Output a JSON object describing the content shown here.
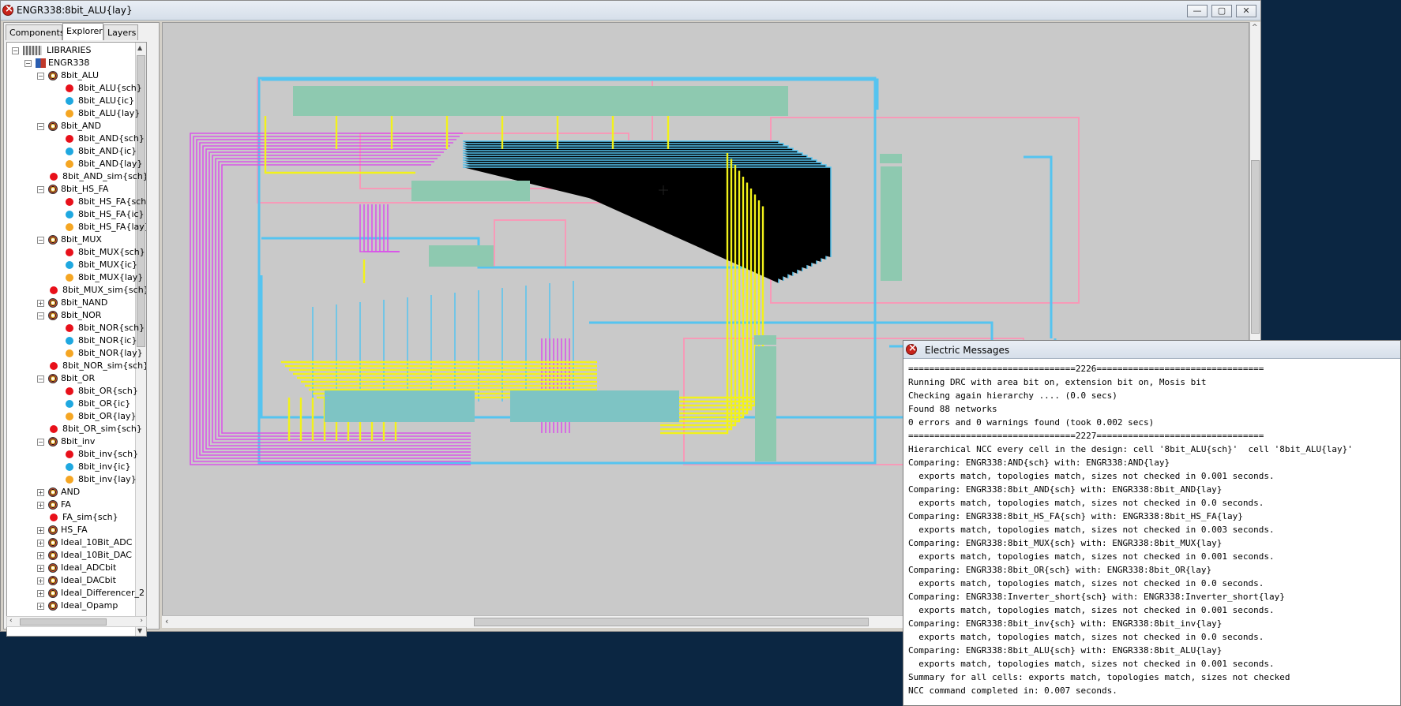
{
  "window": {
    "title": "ENGR338:8bit_ALU{lay}",
    "minimize": "—",
    "maximize": "▢",
    "close": "✕"
  },
  "tabs": [
    {
      "label": "Components"
    },
    {
      "label": "Explorer"
    },
    {
      "label": "Layers"
    }
  ],
  "tree": [
    {
      "label": "LIBRARIES",
      "level": 0,
      "icon": "libraries-icon",
      "expander": "⊟"
    },
    {
      "label": "ENGR338",
      "level": 1,
      "icon": "library-icon",
      "expander": "⊟"
    },
    {
      "label": "8bit_ALU",
      "level": 2,
      "icon": "cell-icon",
      "expander": "⊟"
    },
    {
      "label": "8bit_ALU{sch}",
      "level": 3,
      "icon": "schematic-dot-icon"
    },
    {
      "label": "8bit_ALU{ic}",
      "level": 3,
      "icon": "icon-dot-icon"
    },
    {
      "label": "8bit_ALU{lay}",
      "level": 3,
      "icon": "layout-dot-icon"
    },
    {
      "label": "8bit_AND",
      "level": 2,
      "icon": "cell-icon",
      "expander": "⊟"
    },
    {
      "label": "8bit_AND{sch}",
      "level": 3,
      "icon": "schematic-dot-icon"
    },
    {
      "label": "8bit_AND{ic}",
      "level": 3,
      "icon": "icon-dot-icon"
    },
    {
      "label": "8bit_AND{lay}",
      "level": 3,
      "icon": "layout-dot-icon"
    },
    {
      "label": "8bit_AND_sim{sch}",
      "level": 2,
      "icon": "schematic-dot-icon"
    },
    {
      "label": "8bit_HS_FA",
      "level": 2,
      "icon": "cell-icon",
      "expander": "⊟"
    },
    {
      "label": "8bit_HS_FA{sch",
      "level": 3,
      "icon": "schematic-dot-icon"
    },
    {
      "label": "8bit_HS_FA{ic}",
      "level": 3,
      "icon": "icon-dot-icon"
    },
    {
      "label": "8bit_HS_FA{lay}",
      "level": 3,
      "icon": "layout-dot-icon"
    },
    {
      "label": "8bit_MUX",
      "level": 2,
      "icon": "cell-icon",
      "expander": "⊟"
    },
    {
      "label": "8bit_MUX{sch}",
      "level": 3,
      "icon": "schematic-dot-icon"
    },
    {
      "label": "8bit_MUX{ic}",
      "level": 3,
      "icon": "icon-dot-icon"
    },
    {
      "label": "8bit_MUX{lay}",
      "level": 3,
      "icon": "layout-dot-icon"
    },
    {
      "label": "8bit_MUX_sim{sch}",
      "level": 2,
      "icon": "schematic-dot-icon"
    },
    {
      "label": "8bit_NAND",
      "level": 2,
      "icon": "cell-icon",
      "expander": "⊞"
    },
    {
      "label": "8bit_NOR",
      "level": 2,
      "icon": "cell-icon",
      "expander": "⊟"
    },
    {
      "label": "8bit_NOR{sch}",
      "level": 3,
      "icon": "schematic-dot-icon"
    },
    {
      "label": "8bit_NOR{ic}",
      "level": 3,
      "icon": "icon-dot-icon"
    },
    {
      "label": "8bit_NOR{lay}",
      "level": 3,
      "icon": "layout-dot-icon"
    },
    {
      "label": "8bit_NOR_sim{sch}",
      "level": 2,
      "icon": "schematic-dot-icon"
    },
    {
      "label": "8bit_OR",
      "level": 2,
      "icon": "cell-icon",
      "expander": "⊟"
    },
    {
      "label": "8bit_OR{sch}",
      "level": 3,
      "icon": "schematic-dot-icon"
    },
    {
      "label": "8bit_OR{ic}",
      "level": 3,
      "icon": "icon-dot-icon"
    },
    {
      "label": "8bit_OR{lay}",
      "level": 3,
      "icon": "layout-dot-icon"
    },
    {
      "label": "8bit_OR_sim{sch}",
      "level": 2,
      "icon": "schematic-dot-icon"
    },
    {
      "label": "8bit_inv",
      "level": 2,
      "icon": "cell-icon",
      "expander": "⊟"
    },
    {
      "label": "8bit_inv{sch}",
      "level": 3,
      "icon": "schematic-dot-icon"
    },
    {
      "label": "8bit_inv{ic}",
      "level": 3,
      "icon": "icon-dot-icon"
    },
    {
      "label": "8bit_inv{lay}",
      "level": 3,
      "icon": "layout-dot-icon"
    },
    {
      "label": "AND",
      "level": 2,
      "icon": "cell-icon",
      "expander": "⊞"
    },
    {
      "label": "FA",
      "level": 2,
      "icon": "cell-icon",
      "expander": "⊞"
    },
    {
      "label": "FA_sim{sch}",
      "level": 2,
      "icon": "schematic-dot-icon"
    },
    {
      "label": "HS_FA",
      "level": 2,
      "icon": "cell-icon",
      "expander": "⊞"
    },
    {
      "label": "Ideal_10Bit_ADC",
      "level": 2,
      "icon": "cell-icon",
      "expander": "⊞"
    },
    {
      "label": "Ideal_10Bit_DAC",
      "level": 2,
      "icon": "cell-icon",
      "expander": "⊞"
    },
    {
      "label": "Ideal_ADCbit",
      "level": 2,
      "icon": "cell-icon",
      "expander": "⊞"
    },
    {
      "label": "Ideal_DACbit",
      "level": 2,
      "icon": "cell-icon",
      "expander": "⊞"
    },
    {
      "label": "Ideal_Differencer_2",
      "level": 2,
      "icon": "cell-icon",
      "expander": "⊞"
    },
    {
      "label": "Ideal_Opamp",
      "level": 2,
      "icon": "cell-icon",
      "expander": "⊞"
    }
  ],
  "colors": {
    "schematic": "#e8101a",
    "icon_view": "#1fa8e0",
    "layout": "#f5a623",
    "poly_magenta": "#d957e8",
    "metal_blue": "#55c4f0",
    "metal_yellow": "#f2f21a",
    "outline_pink": "#f79ab8",
    "well_green": "#8ec9b0",
    "canvas_bg": "#c9c9c9",
    "desktop": "#0b2642"
  },
  "messages": {
    "title": "Electric Messages",
    "lines": [
      "================================2226================================",
      "Running DRC with area bit on, extension bit on, Mosis bit",
      "Checking again hierarchy .... (0.0 secs)",
      "Found 88 networks",
      "0 errors and 0 warnings found (took 0.002 secs)",
      "================================2227================================",
      "Hierarchical NCC every cell in the design: cell '8bit_ALU{sch}'  cell '8bit_ALU{lay}'",
      "Comparing: ENGR338:AND{sch} with: ENGR338:AND{lay}",
      "  exports match, topologies match, sizes not checked in 0.001 seconds.",
      "Comparing: ENGR338:8bit_AND{sch} with: ENGR338:8bit_AND{lay}",
      "  exports match, topologies match, sizes not checked in 0.0 seconds.",
      "Comparing: ENGR338:8bit_HS_FA{sch} with: ENGR338:8bit_HS_FA{lay}",
      "  exports match, topologies match, sizes not checked in 0.003 seconds.",
      "Comparing: ENGR338:8bit_MUX{sch} with: ENGR338:8bit_MUX{lay}",
      "  exports match, topologies match, sizes not checked in 0.001 seconds.",
      "Comparing: ENGR338:8bit_OR{sch} with: ENGR338:8bit_OR{lay}",
      "  exports match, topologies match, sizes not checked in 0.0 seconds.",
      "Comparing: ENGR338:Inverter_short{sch} with: ENGR338:Inverter_short{lay}",
      "  exports match, topologies match, sizes not checked in 0.001 seconds.",
      "Comparing: ENGR338:8bit_inv{sch} with: ENGR338:8bit_inv{lay}",
      "  exports match, topologies match, sizes not checked in 0.0 seconds.",
      "Comparing: ENGR338:8bit_ALU{sch} with: ENGR338:8bit_ALU{lay}",
      "  exports match, topologies match, sizes not checked in 0.001 seconds.",
      "Summary for all cells: exports match, topologies match, sizes not checked",
      "NCC command completed in: 0.007 seconds."
    ]
  }
}
